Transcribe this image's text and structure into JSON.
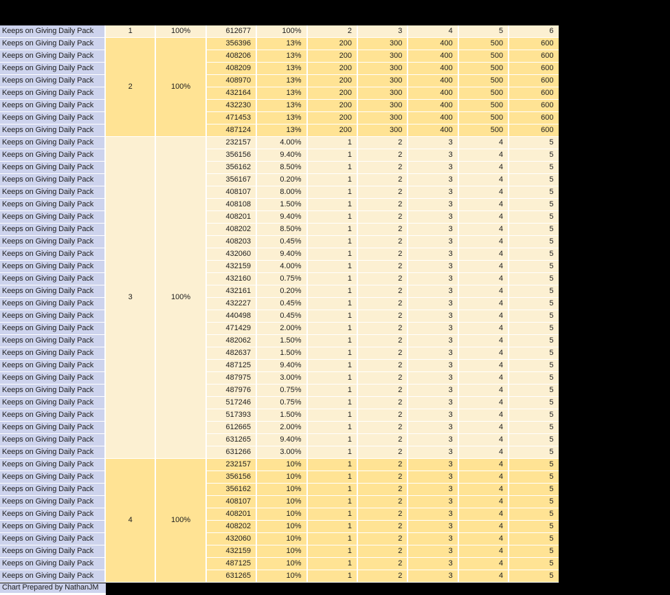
{
  "colors": {
    "gold": "#ffe394",
    "cream": "#fcf0d2",
    "lavender": "#cdd3ed",
    "gridline": "#ffffff",
    "mask_black": "#000000",
    "text": "#1c1c1c"
  },
  "footer": {
    "text": "Chart Prepared by NathanJM"
  },
  "table": {
    "row_label": "Keeps on Giving Daily Pack",
    "groups": [
      {
        "num": "1",
        "pct": "100%",
        "fill": "cream",
        "row_values": [
          "2",
          "3",
          "4",
          "5",
          "6"
        ],
        "rows": [
          {
            "id": "612677",
            "pct": "100%"
          }
        ]
      },
      {
        "num": "2",
        "pct": "100%",
        "fill": "gold",
        "row_values": [
          "200",
          "300",
          "400",
          "500",
          "600"
        ],
        "rows": [
          {
            "id": "356396",
            "pct": "13%"
          },
          {
            "id": "408206",
            "pct": "13%"
          },
          {
            "id": "408209",
            "pct": "13%"
          },
          {
            "id": "408970",
            "pct": "13%"
          },
          {
            "id": "432164",
            "pct": "13%"
          },
          {
            "id": "432230",
            "pct": "13%"
          },
          {
            "id": "471453",
            "pct": "13%"
          },
          {
            "id": "487124",
            "pct": "13%"
          }
        ]
      },
      {
        "num": "3",
        "pct": "100%",
        "fill": "cream",
        "row_values": [
          "1",
          "2",
          "3",
          "4",
          "5"
        ],
        "rows": [
          {
            "id": "232157",
            "pct": "4.00%"
          },
          {
            "id": "356156",
            "pct": "9.40%"
          },
          {
            "id": "356162",
            "pct": "8.50%"
          },
          {
            "id": "356167",
            "pct": "0.20%"
          },
          {
            "id": "408107",
            "pct": "8.00%"
          },
          {
            "id": "408108",
            "pct": "1.50%"
          },
          {
            "id": "408201",
            "pct": "9.40%"
          },
          {
            "id": "408202",
            "pct": "8.50%"
          },
          {
            "id": "408203",
            "pct": "0.45%"
          },
          {
            "id": "432060",
            "pct": "9.40%"
          },
          {
            "id": "432159",
            "pct": "4.00%"
          },
          {
            "id": "432160",
            "pct": "0.75%"
          },
          {
            "id": "432161",
            "pct": "0.20%"
          },
          {
            "id": "432227",
            "pct": "0.45%"
          },
          {
            "id": "440498",
            "pct": "0.45%"
          },
          {
            "id": "471429",
            "pct": "2.00%"
          },
          {
            "id": "482062",
            "pct": "1.50%"
          },
          {
            "id": "482637",
            "pct": "1.50%"
          },
          {
            "id": "487125",
            "pct": "9.40%"
          },
          {
            "id": "487975",
            "pct": "3.00%"
          },
          {
            "id": "487976",
            "pct": "0.75%"
          },
          {
            "id": "517246",
            "pct": "0.75%"
          },
          {
            "id": "517393",
            "pct": "1.50%"
          },
          {
            "id": "612665",
            "pct": "2.00%"
          },
          {
            "id": "631265",
            "pct": "9.40%"
          },
          {
            "id": "631266",
            "pct": "3.00%"
          }
        ]
      },
      {
        "num": "4",
        "pct": "100%",
        "fill": "gold",
        "row_values": [
          "1",
          "2",
          "3",
          "4",
          "5"
        ],
        "rows": [
          {
            "id": "232157",
            "pct": "10%"
          },
          {
            "id": "356156",
            "pct": "10%"
          },
          {
            "id": "356162",
            "pct": "10%"
          },
          {
            "id": "408107",
            "pct": "10%"
          },
          {
            "id": "408201",
            "pct": "10%"
          },
          {
            "id": "408202",
            "pct": "10%"
          },
          {
            "id": "432060",
            "pct": "10%"
          },
          {
            "id": "432159",
            "pct": "10%"
          },
          {
            "id": "487125",
            "pct": "10%"
          },
          {
            "id": "631265",
            "pct": "10%"
          }
        ]
      }
    ]
  }
}
